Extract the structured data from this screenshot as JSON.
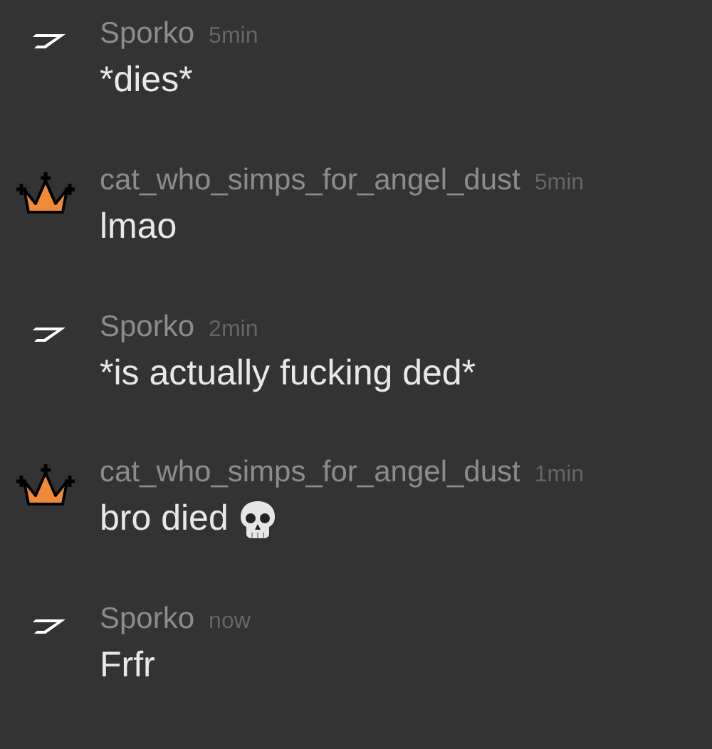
{
  "messages": [
    {
      "avatar": {
        "kind": "bolt"
      },
      "author": "Sporko",
      "time": "5min",
      "text": "*dies*"
    },
    {
      "avatar": {
        "kind": "crown"
      },
      "author": "cat_who_simps_for_angel_dust",
      "time": "5min",
      "text": "lmao"
    },
    {
      "avatar": {
        "kind": "bolt"
      },
      "author": "Sporko",
      "time": "2min",
      "text": "*is actually fucking ded*"
    },
    {
      "avatar": {
        "kind": "crown"
      },
      "author": "cat_who_simps_for_angel_dust",
      "time": "1min",
      "text": "bro died",
      "emoji": {
        "kind": "skull"
      }
    },
    {
      "avatar": {
        "kind": "bolt"
      },
      "author": "Sporko",
      "time": "now",
      "text": "Frfr"
    }
  ]
}
